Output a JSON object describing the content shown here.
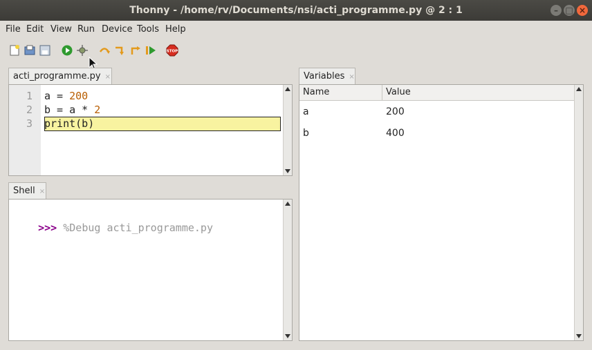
{
  "window": {
    "title": "Thonny  -  /home/rv/Documents/nsi/acti_programme.py  @  2 : 1",
    "minimize_glyph": "–",
    "maximize_glyph": "□",
    "close_glyph": "×"
  },
  "menu": [
    "File",
    "Edit",
    "View",
    "Run",
    "Device",
    "Tools",
    "Help"
  ],
  "toolbar": {
    "icons": [
      "new-file-icon",
      "open-file-icon",
      "save-file-icon",
      "run-icon",
      "debug-icon",
      "step-over-icon",
      "step-into-icon",
      "step-out-icon",
      "resume-icon",
      "stop-icon"
    ],
    "stop_label": "STOP",
    "colors": {
      "run": "#2f9a2f",
      "stop": "#d62d20",
      "step": "#e39a1d"
    }
  },
  "editor": {
    "tab_label": "acti_programme.py",
    "tab_close": "×",
    "lines": [
      {
        "num": "1",
        "parts": [
          "a = ",
          "200"
        ]
      },
      {
        "num": "2",
        "parts": [
          "b = a * ",
          "2"
        ]
      },
      {
        "num": "3",
        "parts": [
          "print(b)",
          ""
        ]
      }
    ],
    "highlight_color": "#f8f3a0"
  },
  "shell": {
    "tab_label": "Shell",
    "tab_close": "×",
    "prompt": ">>>",
    "command": "%Debug acti_programme.py",
    "prompt_color": "#8b008b"
  },
  "variables": {
    "tab_label": "Variables",
    "tab_close": "×",
    "columns": [
      "Name",
      "Value"
    ],
    "rows": [
      {
        "name": "a",
        "value": "200"
      },
      {
        "name": "b",
        "value": "400"
      }
    ]
  }
}
